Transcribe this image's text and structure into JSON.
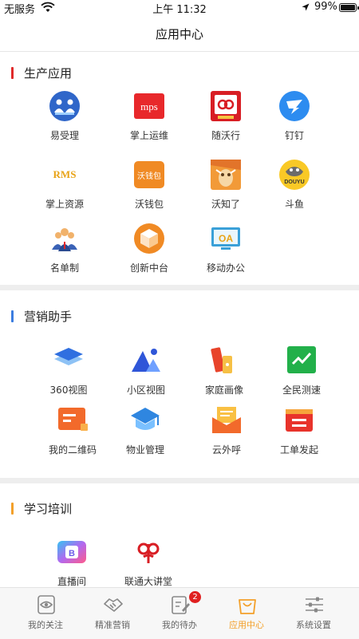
{
  "status_bar": {
    "carrier": "无服务",
    "time": "上午 11:32",
    "battery": "99%"
  },
  "nav": {
    "title": "应用中心"
  },
  "sections": [
    {
      "title": "生产应用",
      "accent": "#e02a2a",
      "apps": [
        {
          "label": "易受理",
          "icon": "service-people-icon"
        },
        {
          "label": "掌上运维",
          "icon": "mps-icon"
        },
        {
          "label": "随沃行",
          "icon": "unicom-icon"
        },
        {
          "label": "钉钉",
          "icon": "dingtalk-icon"
        },
        {
          "label": "掌上资源",
          "icon": "rms-icon",
          "text": "RMS"
        },
        {
          "label": "沃钱包",
          "icon": "wallet-icon",
          "text": "沃钱包"
        },
        {
          "label": "沃知了",
          "icon": "cicada-icon"
        },
        {
          "label": "斗鱼",
          "icon": "douyu-icon",
          "text": "DOUYU"
        },
        {
          "label": "名单制",
          "icon": "people-roster-icon"
        },
        {
          "label": "创新中台",
          "icon": "innovation-cube-icon"
        },
        {
          "label": "移动办公",
          "icon": "oa-icon",
          "text": "OA"
        }
      ]
    },
    {
      "title": "营销助手",
      "accent": "#3b7de0",
      "apps": [
        {
          "label": "360视图",
          "icon": "layers-icon"
        },
        {
          "label": "小区视图",
          "icon": "mountain-icon"
        },
        {
          "label": "家庭画像",
          "icon": "palette-icon"
        },
        {
          "label": "全民测速",
          "icon": "speed-chart-icon"
        },
        {
          "label": "我的二维码",
          "icon": "chat-card-icon"
        },
        {
          "label": "物业管理",
          "icon": "graduation-cap-icon"
        },
        {
          "label": "云外呼",
          "icon": "envelope-icon"
        },
        {
          "label": "工单发起",
          "icon": "ticket-icon"
        }
      ]
    },
    {
      "title": "学习培训",
      "accent": "#f3a02a",
      "apps": [
        {
          "label": "直播间",
          "icon": "live-tv-icon"
        },
        {
          "label": "联通大讲堂",
          "icon": "unicom-knot-icon"
        }
      ]
    }
  ],
  "tabs": [
    {
      "label": "我的关注",
      "icon": "eye-card-icon",
      "active": false
    },
    {
      "label": "精准营销",
      "icon": "handshake-icon",
      "active": false
    },
    {
      "label": "我的待办",
      "icon": "todo-edit-icon",
      "active": false,
      "badge": "2"
    },
    {
      "label": "应用中心",
      "icon": "shopping-bag-icon",
      "active": true
    },
    {
      "label": "系统设置",
      "icon": "sliders-icon",
      "active": false
    }
  ],
  "colors": {
    "active_tab": "#f3a02a",
    "section_gap": "#eeeeee"
  }
}
